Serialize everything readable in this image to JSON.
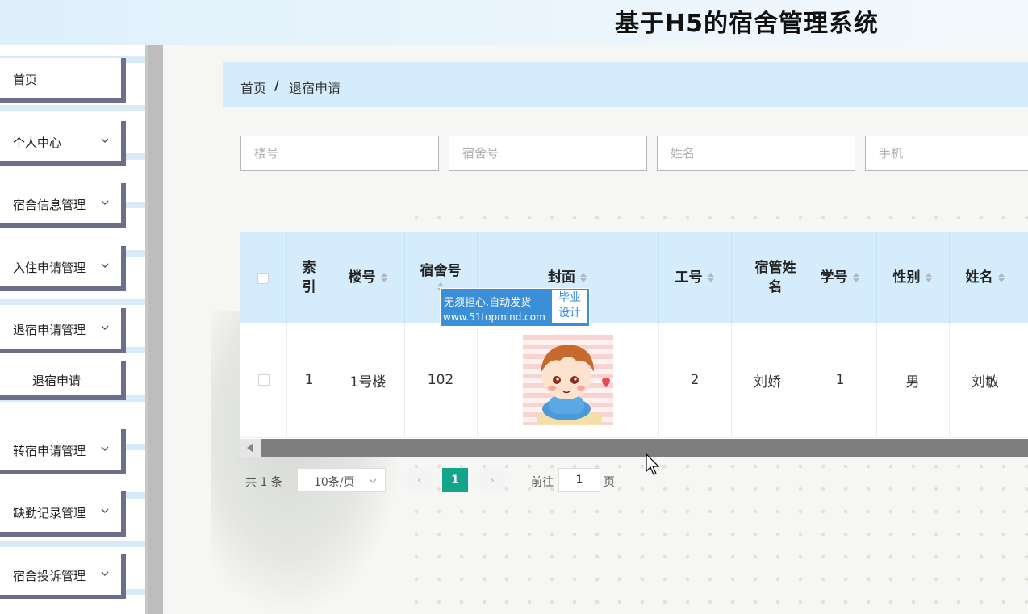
{
  "header": {
    "title": "基于H5的宿舍管理系统"
  },
  "sidebar": {
    "items": [
      {
        "label": "首页",
        "has_children": false
      },
      {
        "label": "个人中心",
        "has_children": true
      },
      {
        "label": "宿舍信息管理",
        "has_children": true
      },
      {
        "label": "入住申请管理",
        "has_children": true
      },
      {
        "label": "退宿申请管理",
        "has_children": true
      },
      {
        "label": "退宿申请",
        "has_children": false,
        "sub": true
      },
      {
        "label": "转宿申请管理",
        "has_children": true
      },
      {
        "label": "缺勤记录管理",
        "has_children": true
      },
      {
        "label": "宿舍投诉管理",
        "has_children": true
      }
    ]
  },
  "breadcrumb": {
    "home": "首页",
    "separator": "/",
    "current": "退宿申请"
  },
  "search": {
    "building_placeholder": "楼号",
    "room_placeholder": "宿舍号",
    "name_placeholder": "姓名",
    "phone_placeholder": "手机"
  },
  "table": {
    "headers": {
      "index": "索引",
      "building": "楼号",
      "room": "宿舍号",
      "cover": "封面",
      "job_no": "工号",
      "manager_name": "宿管姓名",
      "student_no": "学号",
      "gender": "性别",
      "name": "姓名"
    },
    "rows": [
      {
        "index": "1",
        "building": "1号楼",
        "room": "102",
        "cover": "cartoon-boy-image",
        "job_no": "2",
        "manager_name": "刘娇",
        "student_no": "1",
        "gender": "男",
        "name": "刘敏"
      }
    ]
  },
  "watermark": {
    "main": "无须担心.自动发货",
    "url": "www.51topmind.com",
    "side_line1": "毕业",
    "side_line2": "设计"
  },
  "pagination": {
    "total": "共 1 条",
    "page_size": "10条/页",
    "current_page": "1",
    "goto_label": "前往",
    "goto_value": "1",
    "page_suffix": "页"
  },
  "colors": {
    "header_bg": "#d4ecfb",
    "active_page": "#13a58a",
    "sidebar_border": "#6d6d8c"
  }
}
